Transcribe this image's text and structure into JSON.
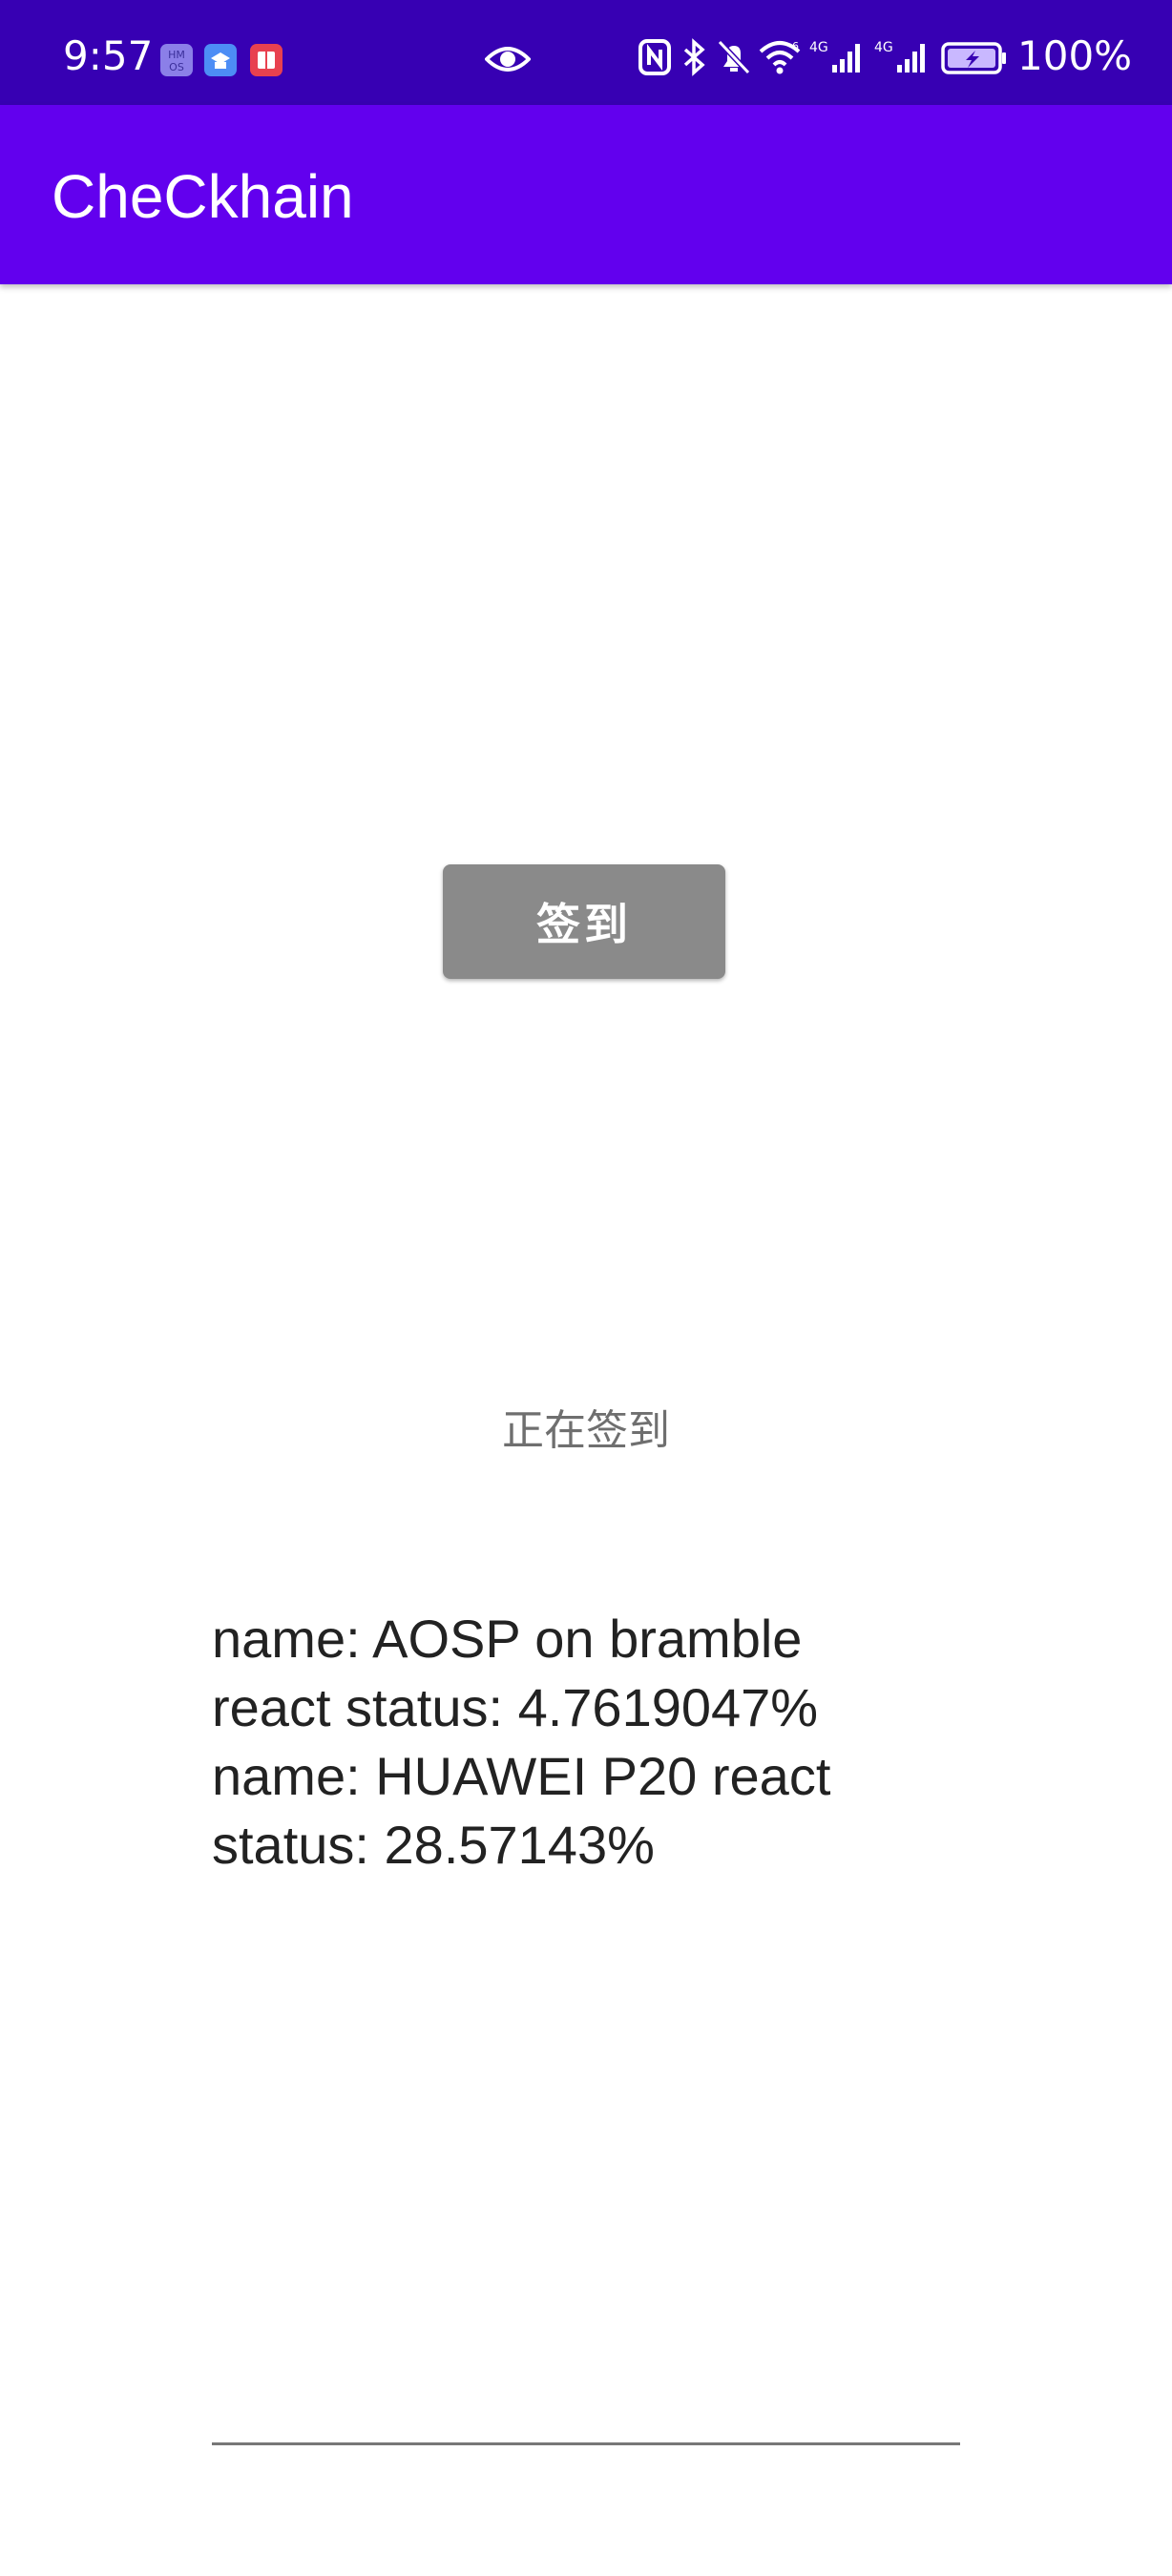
{
  "status_bar": {
    "time": "9:57",
    "battery": "100%",
    "icons": [
      "hmos-app-icon",
      "learning-app-icon",
      "book-app-icon",
      "eye-icon",
      "nfc-icon",
      "bluetooth-icon",
      "mute-icon",
      "wifi-icon",
      "4g-signal-icon",
      "4g-signal-icon-2",
      "battery-icon"
    ]
  },
  "app_bar": {
    "title": "CheCkhain"
  },
  "main": {
    "checkin_button_label": "签到",
    "status_text": "正在签到",
    "result_lines": [
      "name: AOSP on bramble",
      "react status: 4.7619047%",
      "name: HUAWEI P20 react",
      "status: 28.57143%"
    ]
  },
  "colors": {
    "status_bar": "#3700b3",
    "app_bar": "#6200ee",
    "button": "#8a8a8a"
  }
}
